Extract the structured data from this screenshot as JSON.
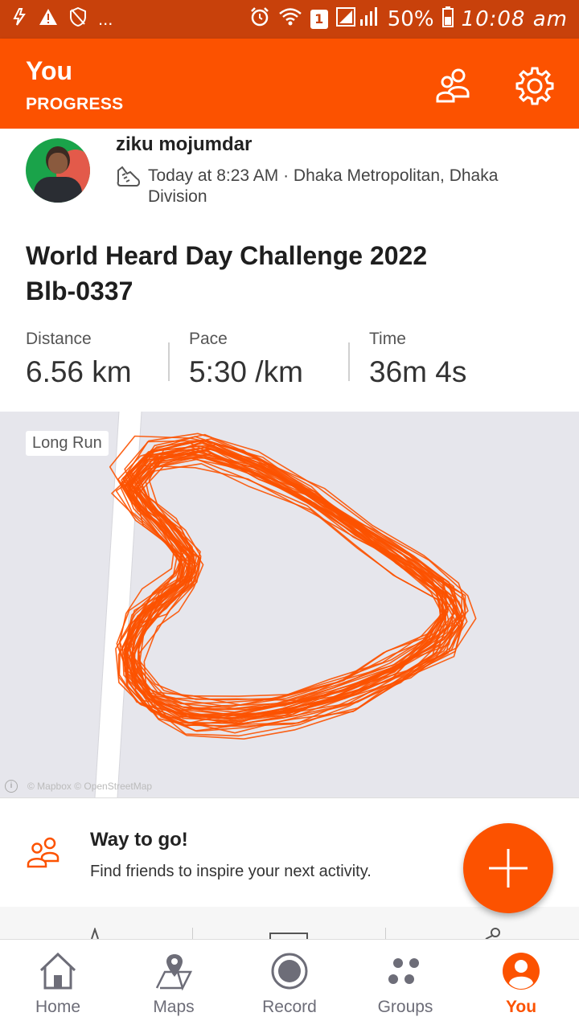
{
  "status_bar": {
    "battery": "50%",
    "time": "10:08 am",
    "sim_badge": "1",
    "more": "..."
  },
  "header": {
    "title": "You",
    "subtitle": "PROGRESS",
    "icons": [
      "people-icon",
      "gear-icon"
    ]
  },
  "activity": {
    "athlete": "ziku mojumdar",
    "meta": "Today at 8:23 AM · Dhaka Metropolitan, Dhaka Division",
    "title_line1": "World Heard  Day Challenge 2022",
    "title_line2": "Blb-0337",
    "stats": [
      {
        "label": "Distance",
        "value": "6.56 km"
      },
      {
        "label": "Pace",
        "value": "5:30 /km"
      },
      {
        "label": "Time",
        "value": "36m 4s"
      }
    ],
    "map_badge": "Long Run",
    "route_color": "#fc5200",
    "map_attribution": "© Mapbox © OpenStreetMap"
  },
  "friends_banner": {
    "title": "Way to go!",
    "text": "Find friends to inspire your next activity."
  },
  "bottom_nav": [
    {
      "label": "Home",
      "icon": "home-icon",
      "active": false
    },
    {
      "label": "Maps",
      "icon": "map-pin-icon",
      "active": false
    },
    {
      "label": "Record",
      "icon": "record-icon",
      "active": false
    },
    {
      "label": "Groups",
      "icon": "groups-icon",
      "active": false
    },
    {
      "label": "You",
      "icon": "profile-icon",
      "active": true
    }
  ],
  "colors": {
    "brand": "#fc5200",
    "status_bar": "#c8410b",
    "map_bg": "#e6e6ec"
  }
}
